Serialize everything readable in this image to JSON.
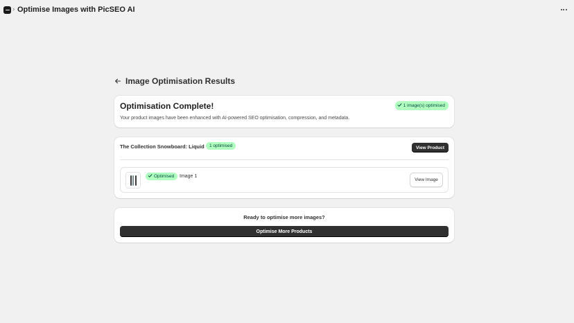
{
  "header": {
    "app_title": "Optimise Images with PicSEO AI",
    "breadcrumb_separator": "›"
  },
  "page": {
    "title": "Image Optimisation Results"
  },
  "summary_card": {
    "title": "Optimisation Complete!",
    "badge": "1 image(s) optimised",
    "description": "Your product images have been enhanced with AI-powered SEO optimisation, compression, and metadata."
  },
  "product_card": {
    "product_name": "The Collection Snowboard: Liquid",
    "count_badge": "1 optimised",
    "view_product_label": "View Product",
    "images": [
      {
        "status": "Optimised",
        "label": "Image 1",
        "view_label": "View Image"
      }
    ]
  },
  "more_card": {
    "question": "Ready to optimise more images?",
    "button_label": "Optimise More Products"
  },
  "colors": {
    "success_bg": "#affebf",
    "success_text": "#014b40",
    "primary_button": "#303030",
    "page_bg": "#f1f1f1"
  },
  "icons": {
    "app": "app-icon",
    "more": "more-horizontal-icon",
    "back": "arrow-left-icon",
    "check": "checkmark-icon"
  }
}
